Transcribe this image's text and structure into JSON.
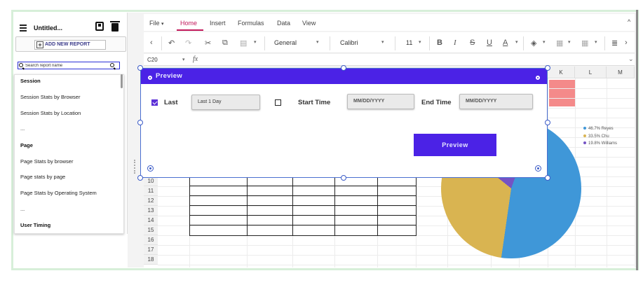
{
  "left_panel": {
    "report_title": "Untitled...",
    "add_report_label": "ADD NEW REPORT",
    "search_placeholder": "Search report name",
    "items": [
      {
        "label": "Session",
        "header": true
      },
      {
        "label": "Session Stats by Browser",
        "header": false
      },
      {
        "label": "Session Stats by Location",
        "header": false
      },
      {
        "label": "...",
        "header": false
      },
      {
        "label": "Page",
        "header": true
      },
      {
        "label": "Page Stats by browser",
        "header": false
      },
      {
        "label": "Page stats by page",
        "header": false
      },
      {
        "label": "Page Stats by Operating System",
        "header": false
      },
      {
        "label": "...",
        "header": false
      },
      {
        "label": "User Timing",
        "header": true
      }
    ]
  },
  "menu": {
    "file": "File",
    "home": "Home",
    "insert": "Insert",
    "formulas": "Formulas",
    "data": "Data",
    "view": "View"
  },
  "toolbar": {
    "number_format": "General",
    "font_name": "Calibri",
    "font_size": "11"
  },
  "formula_bar": {
    "cell_ref": "C20",
    "fx_label": "fx"
  },
  "columns": [
    "K",
    "L",
    "M"
  ],
  "rows": [
    "10",
    "11",
    "12",
    "13",
    "14",
    "15",
    "16",
    "17",
    "18"
  ],
  "dialog": {
    "title": "Preview",
    "last_label": "Last",
    "last_value": "Last 1 Day",
    "start_label": "Start Time",
    "start_placeholder": "MM/DD/YYYY",
    "end_label": "End Time",
    "end_placeholder": "MM/DD/YYYY",
    "preview_button": "Preview"
  },
  "chart_data": {
    "type": "pie",
    "legend": "top-right",
    "slices": [
      {
        "label": "46.7% Reyes",
        "value": 46.7,
        "color": "#3f97d8"
      },
      {
        "label": "33.5% Chu",
        "value": 33.5,
        "color": "#d9b451"
      },
      {
        "label": "19.8% Williams",
        "value": 19.8,
        "color": "#7453c4"
      }
    ]
  },
  "colors": {
    "accent": "#4b22e6",
    "menu_active": "#c2185b",
    "highlight_cell": "#f48a8a"
  }
}
